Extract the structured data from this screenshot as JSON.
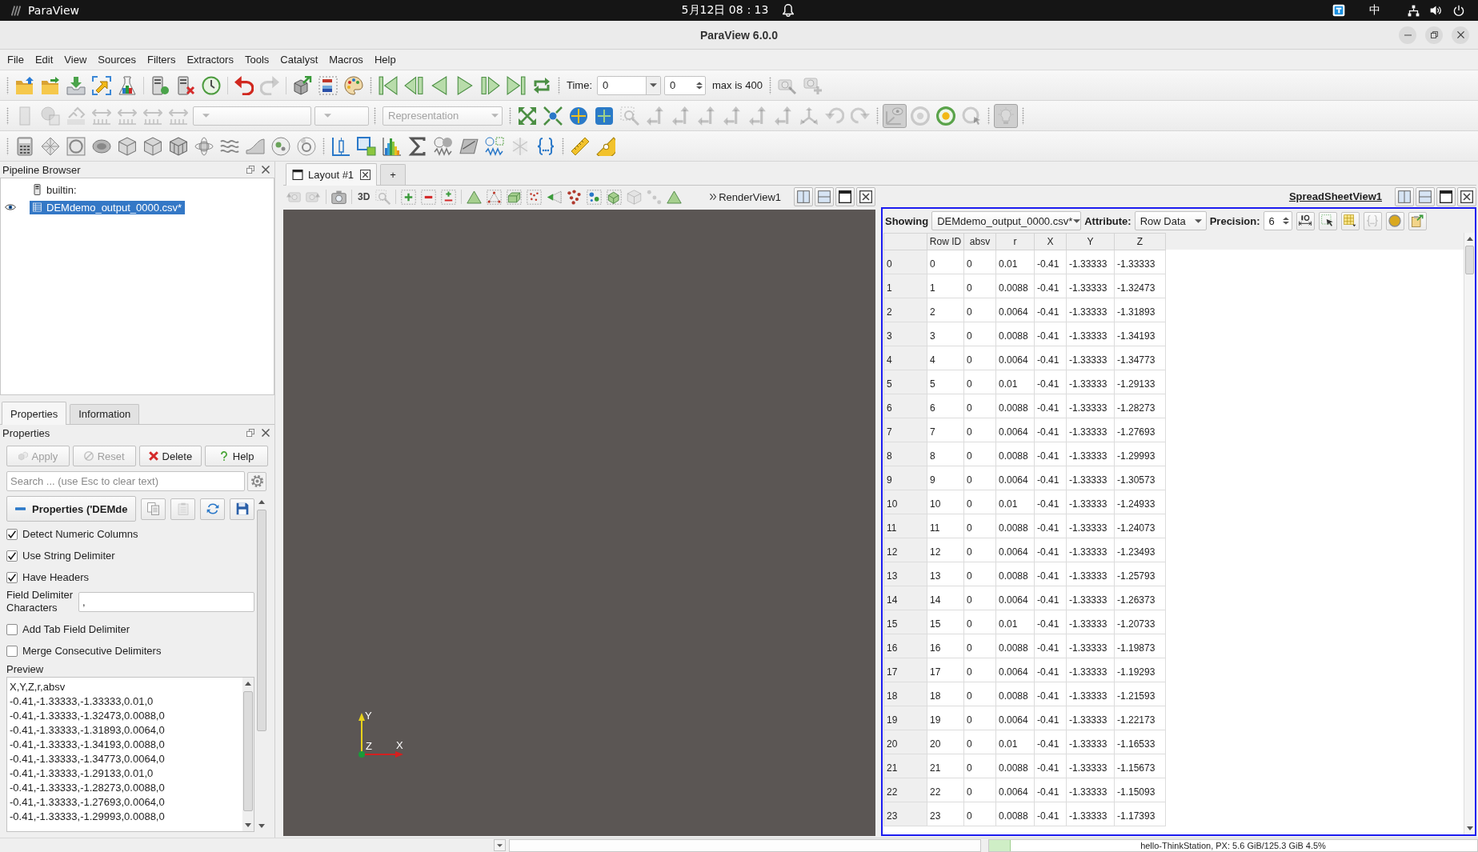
{
  "system_bar": {
    "app_name": "ParaView",
    "clock": "5月12日 08：13",
    "input_method": "中"
  },
  "window": {
    "title": "ParaView 6.0.0"
  },
  "menu": [
    "File",
    "Edit",
    "View",
    "Sources",
    "Filters",
    "Extractors",
    "Tools",
    "Catalyst",
    "Macros",
    "Help"
  ],
  "toolbar_rows": [
    {
      "items": [
        {
          "kind": "grip"
        },
        {
          "kind": "icon",
          "disabled": false
        },
        {
          "kind": "icon",
          "disabled": false
        },
        {
          "kind": "icon",
          "disabled": false
        },
        {
          "kind": "icon",
          "disabled": false
        },
        {
          "kind": "icon",
          "disabled": false
        },
        {
          "kind": "separator"
        },
        {
          "kind": "icon",
          "disabled": false
        },
        {
          "kind": "icon",
          "disabled": false
        },
        {
          "kind": "icon",
          "disabled": false
        },
        {
          "kind": "separator"
        },
        {
          "kind": "icon",
          "disabled": false
        },
        {
          "kind": "icon",
          "disabled": true
        },
        {
          "kind": "separator"
        },
        {
          "kind": "icon",
          "disabled": false
        },
        {
          "kind": "icon",
          "disabled": false
        },
        {
          "kind": "icon",
          "disabled": false
        },
        {
          "kind": "grip"
        },
        {
          "kind": "icon",
          "disabled": false
        },
        {
          "kind": "icon",
          "disabled": false
        },
        {
          "kind": "icon",
          "disabled": false
        },
        {
          "kind": "icon",
          "disabled": false
        },
        {
          "kind": "icon",
          "disabled": false
        },
        {
          "kind": "icon",
          "disabled": false
        },
        {
          "kind": "icon",
          "disabled": false
        },
        {
          "kind": "grip"
        },
        {
          "kind": "label",
          "text": "Time:"
        },
        {
          "kind": "combo",
          "value": "0"
        },
        {
          "kind": "spin",
          "value": "0"
        },
        {
          "kind": "label",
          "text": "max is 400"
        },
        {
          "kind": "grip"
        },
        {
          "kind": "icon",
          "disabled": true
        },
        {
          "kind": "icon",
          "disabled": true
        }
      ]
    },
    {
      "items": [
        {
          "kind": "grip"
        },
        {
          "kind": "icon",
          "disabled": true,
          "checked": false
        },
        {
          "kind": "icon",
          "disabled": true,
          "checked": false
        },
        {
          "kind": "icon",
          "disabled": true,
          "checked": false
        },
        {
          "kind": "icon",
          "disabled": true,
          "checked": false
        },
        {
          "kind": "icon",
          "disabled": true,
          "checked": false
        },
        {
          "kind": "icon",
          "disabled": true,
          "checked": false
        },
        {
          "kind": "icon",
          "disabled": true,
          "checked": false
        },
        {
          "kind": "combo",
          "disabled": true
        },
        {
          "kind": "combo",
          "disabled": true
        },
        {
          "kind": "grip"
        },
        {
          "kind": "combo",
          "value": "Representation",
          "disabled": true
        },
        {
          "kind": "grip"
        },
        {
          "kind": "icon",
          "disabled": false,
          "checked": false
        },
        {
          "kind": "icon",
          "disabled": false,
          "checked": false
        },
        {
          "kind": "icon",
          "disabled": false,
          "checked": false
        },
        {
          "kind": "icon",
          "disabled": false,
          "checked": false
        },
        {
          "kind": "icon",
          "disabled": true,
          "checked": false
        },
        {
          "kind": "icon",
          "disabled": true,
          "checked": false
        },
        {
          "kind": "icon",
          "disabled": true,
          "checked": false
        },
        {
          "kind": "icon",
          "disabled": true,
          "checked": false
        },
        {
          "kind": "icon",
          "disabled": true,
          "checked": false
        },
        {
          "kind": "icon",
          "disabled": true,
          "checked": false
        },
        {
          "kind": "icon",
          "disabled": true,
          "checked": false
        },
        {
          "kind": "icon",
          "disabled": true,
          "checked": false
        },
        {
          "kind": "icon",
          "disabled": true,
          "checked": false
        },
        {
          "kind": "icon",
          "disabled": true,
          "checked": false
        },
        {
          "kind": "grip"
        },
        {
          "kind": "icon",
          "disabled": true,
          "checked": true
        },
        {
          "kind": "icon",
          "disabled": true,
          "checked": false
        },
        {
          "kind": "icon",
          "disabled": false,
          "checked": false
        },
        {
          "kind": "icon",
          "disabled": true,
          "checked": false
        },
        {
          "kind": "grip"
        },
        {
          "kind": "icon",
          "disabled": true,
          "checked": true
        },
        {
          "kind": "grip"
        }
      ]
    },
    {
      "items": [
        {
          "kind": "grip"
        },
        {
          "kind": "icon",
          "disabled": false
        },
        {
          "kind": "icon",
          "disabled": false
        },
        {
          "kind": "icon",
          "disabled": false
        },
        {
          "kind": "icon",
          "disabled": false
        },
        {
          "kind": "icon",
          "disabled": false
        },
        {
          "kind": "icon",
          "disabled": false
        },
        {
          "kind": "icon",
          "disabled": false
        },
        {
          "kind": "icon",
          "disabled": false
        },
        {
          "kind": "icon",
          "disabled": false
        },
        {
          "kind": "icon",
          "disabled": false
        },
        {
          "kind": "icon",
          "disabled": false
        },
        {
          "kind": "icon",
          "disabled": false
        },
        {
          "kind": "grip"
        },
        {
          "kind": "icon",
          "disabled": false
        },
        {
          "kind": "icon",
          "disabled": false
        },
        {
          "kind": "icon",
          "disabled": false
        },
        {
          "kind": "icon",
          "disabled": false
        },
        {
          "kind": "icon",
          "disabled": false
        },
        {
          "kind": "icon",
          "disabled": false
        },
        {
          "kind": "icon",
          "disabled": false
        },
        {
          "kind": "icon",
          "disabled": true
        },
        {
          "kind": "icon",
          "disabled": false
        },
        {
          "kind": "grip"
        },
        {
          "kind": "icon",
          "disabled": false
        },
        {
          "kind": "icon",
          "disabled": false
        }
      ]
    }
  ],
  "pipeline_browser": {
    "title": "Pipeline Browser",
    "tree": [
      {
        "label": "builtin:",
        "kind": "server",
        "selected": false,
        "children": [
          {
            "label": "DEMdemo_output_0000.csv*",
            "kind": "source",
            "selected": true,
            "visible": true
          }
        ]
      }
    ]
  },
  "panel_tabs": [
    {
      "label": "Properties",
      "selected": true
    },
    {
      "label": "Information",
      "selected": false
    }
  ],
  "properties": {
    "title": "Properties",
    "buttons": [
      {
        "label": "Apply",
        "disabled": true
      },
      {
        "label": "Reset",
        "disabled": true
      },
      {
        "label": "Delete",
        "disabled": false
      },
      {
        "label": "Help",
        "disabled": false
      }
    ],
    "search": {
      "placeholder": "Search ... (use Esc to clear text)"
    },
    "section": {
      "title": "Properties ('DEMde",
      "tools": [
        {
          "disabled": false
        },
        {
          "disabled": true
        },
        {
          "disabled": false
        },
        {
          "disabled": false
        }
      ]
    },
    "options": [
      {
        "kind": "checkbox",
        "label": "Detect Numeric Columns",
        "checked": true
      },
      {
        "kind": "checkbox",
        "label": "Use String Delimiter",
        "checked": true
      },
      {
        "kind": "checkbox",
        "label": "Have Headers",
        "checked": true
      },
      {
        "kind": "text",
        "label": "Field Delimiter Characters",
        "value": ","
      },
      {
        "kind": "checkbox",
        "label": "Add Tab Field Delimiter",
        "checked": false
      },
      {
        "kind": "checkbox",
        "label": "Merge Consecutive Delimiters",
        "checked": false
      }
    ],
    "preview": {
      "label": "Preview",
      "lines": [
        "X,Y,Z,r,absv",
        "-0.41,-1.33333,-1.33333,0.01,0",
        "-0.41,-1.33333,-1.32473,0.0088,0",
        "-0.41,-1.33333,-1.31893,0.0064,0",
        "-0.41,-1.33333,-1.34193,0.0088,0",
        "-0.41,-1.33333,-1.34773,0.0064,0",
        "-0.41,-1.33333,-1.29133,0.01,0",
        "-0.41,-1.33333,-1.28273,0.0088,0",
        "-0.41,-1.33333,-1.27693,0.0064,0",
        "-0.41,-1.33333,-1.29993,0.0088,0"
      ]
    }
  },
  "layout_tabs": {
    "tabs": [
      {
        "label": "Layout #1",
        "selected": true
      }
    ],
    "add_button": "+"
  },
  "render_view": {
    "title": "RenderView1",
    "toolbar": [
      {
        "kind": "icon",
        "disabled": true
      },
      {
        "kind": "icon",
        "disabled": true
      },
      {
        "kind": "separator"
      },
      {
        "kind": "icon",
        "disabled": false
      },
      {
        "kind": "separator"
      },
      {
        "kind": "text_button",
        "text": "3D"
      },
      {
        "kind": "icon",
        "disabled": true
      },
      {
        "kind": "separator"
      },
      {
        "kind": "icon",
        "disabled": false
      },
      {
        "kind": "icon",
        "disabled": false
      },
      {
        "kind": "icon",
        "disabled": false
      },
      {
        "kind": "separator"
      },
      {
        "kind": "icon",
        "disabled": false
      },
      {
        "kind": "icon",
        "disabled": false
      },
      {
        "kind": "icon",
        "disabled": false
      },
      {
        "kind": "icon",
        "disabled": false
      },
      {
        "kind": "icon",
        "disabled": false
      },
      {
        "kind": "icon",
        "disabled": false
      },
      {
        "kind": "icon",
        "disabled": false
      },
      {
        "kind": "icon",
        "disabled": false
      },
      {
        "kind": "icon",
        "disabled": true
      },
      {
        "kind": "icon",
        "disabled": true
      },
      {
        "kind": "icon",
        "disabled": false
      }
    ],
    "axes": {
      "x": "X",
      "y": "Y",
      "z": "Z"
    }
  },
  "spreadsheet_view": {
    "title": "SpreadSheetView1",
    "showing_label": "Showing",
    "showing": "DEMdemo_output_0000.csv*",
    "attribute_label": "Attribute:",
    "attribute": "Row Data",
    "precision_label": "Precision:",
    "precision": "6",
    "tools": [
      {
        "disabled": false
      },
      {
        "disabled": false
      },
      {
        "disabled": false
      },
      {
        "disabled": true
      },
      {
        "disabled": false
      },
      {
        "disabled": false
      }
    ],
    "table": {
      "columns": [
        "Row ID",
        "absv",
        "r",
        "X",
        "Y",
        "Z"
      ],
      "rows": [
        {
          "header": "0",
          "cells": [
            "0",
            "0",
            "0.01",
            "-0.41",
            "-1.33333",
            "-1.33333"
          ]
        },
        {
          "header": "1",
          "cells": [
            "1",
            "0",
            "0.0088",
            "-0.41",
            "-1.33333",
            "-1.32473"
          ]
        },
        {
          "header": "2",
          "cells": [
            "2",
            "0",
            "0.0064",
            "-0.41",
            "-1.33333",
            "-1.31893"
          ]
        },
        {
          "header": "3",
          "cells": [
            "3",
            "0",
            "0.0088",
            "-0.41",
            "-1.33333",
            "-1.34193"
          ]
        },
        {
          "header": "4",
          "cells": [
            "4",
            "0",
            "0.0064",
            "-0.41",
            "-1.33333",
            "-1.34773"
          ]
        },
        {
          "header": "5",
          "cells": [
            "5",
            "0",
            "0.01",
            "-0.41",
            "-1.33333",
            "-1.29133"
          ]
        },
        {
          "header": "6",
          "cells": [
            "6",
            "0",
            "0.0088",
            "-0.41",
            "-1.33333",
            "-1.28273"
          ]
        },
        {
          "header": "7",
          "cells": [
            "7",
            "0",
            "0.0064",
            "-0.41",
            "-1.33333",
            "-1.27693"
          ]
        },
        {
          "header": "8",
          "cells": [
            "8",
            "0",
            "0.0088",
            "-0.41",
            "-1.33333",
            "-1.29993"
          ]
        },
        {
          "header": "9",
          "cells": [
            "9",
            "0",
            "0.0064",
            "-0.41",
            "-1.33333",
            "-1.30573"
          ]
        },
        {
          "header": "10",
          "cells": [
            "10",
            "0",
            "0.01",
            "-0.41",
            "-1.33333",
            "-1.24933"
          ]
        },
        {
          "header": "11",
          "cells": [
            "11",
            "0",
            "0.0088",
            "-0.41",
            "-1.33333",
            "-1.24073"
          ]
        },
        {
          "header": "12",
          "cells": [
            "12",
            "0",
            "0.0064",
            "-0.41",
            "-1.33333",
            "-1.23493"
          ]
        },
        {
          "header": "13",
          "cells": [
            "13",
            "0",
            "0.0088",
            "-0.41",
            "-1.33333",
            "-1.25793"
          ]
        },
        {
          "header": "14",
          "cells": [
            "14",
            "0",
            "0.0064",
            "-0.41",
            "-1.33333",
            "-1.26373"
          ]
        },
        {
          "header": "15",
          "cells": [
            "15",
            "0",
            "0.01",
            "-0.41",
            "-1.33333",
            "-1.20733"
          ]
        },
        {
          "header": "16",
          "cells": [
            "16",
            "0",
            "0.0088",
            "-0.41",
            "-1.33333",
            "-1.19873"
          ]
        },
        {
          "header": "17",
          "cells": [
            "17",
            "0",
            "0.0064",
            "-0.41",
            "-1.33333",
            "-1.19293"
          ]
        },
        {
          "header": "18",
          "cells": [
            "18",
            "0",
            "0.0088",
            "-0.41",
            "-1.33333",
            "-1.21593"
          ]
        },
        {
          "header": "19",
          "cells": [
            "19",
            "0",
            "0.0064",
            "-0.41",
            "-1.33333",
            "-1.22173"
          ]
        },
        {
          "header": "20",
          "cells": [
            "20",
            "0",
            "0.01",
            "-0.41",
            "-1.33333",
            "-1.16533"
          ]
        },
        {
          "header": "21",
          "cells": [
            "21",
            "0",
            "0.0088",
            "-0.41",
            "-1.33333",
            "-1.15673"
          ]
        },
        {
          "header": "22",
          "cells": [
            "22",
            "0",
            "0.0064",
            "-0.41",
            "-1.33333",
            "-1.15093"
          ]
        },
        {
          "header": "23",
          "cells": [
            "23",
            "0",
            "0.0088",
            "-0.41",
            "-1.33333",
            "-1.17393"
          ]
        }
      ]
    }
  },
  "status_bar": {
    "memory": {
      "text": "hello-ThinkStation, PX: 5.6 GiB/125.3 GiB 4.5%",
      "level": 0.045
    }
  }
}
